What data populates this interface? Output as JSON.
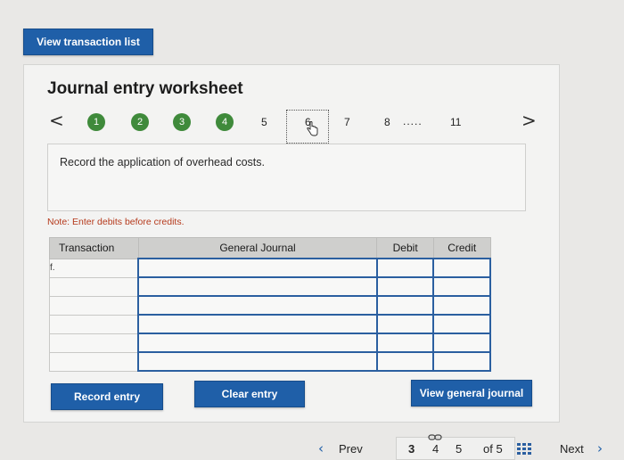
{
  "top": {
    "view_transaction_list": "View transaction list"
  },
  "worksheet": {
    "title": "Journal entry worksheet",
    "nav_prev": "<",
    "nav_next": ">",
    "steps": [
      "1",
      "2",
      "3",
      "4",
      "5",
      "6",
      "7",
      "8",
      "11"
    ],
    "current_step": "6",
    "ellipsis": ".....",
    "prompt": "Record the application of overhead costs.",
    "note": "Note: Enter debits before credits.",
    "table": {
      "headers": [
        "Transaction",
        "General Journal",
        "Debit",
        "Credit"
      ],
      "rows": [
        [
          "f.",
          "",
          "",
          ""
        ],
        [
          "",
          "",
          "",
          ""
        ],
        [
          "",
          "",
          "",
          ""
        ],
        [
          "",
          "",
          "",
          ""
        ],
        [
          "",
          "",
          "",
          ""
        ],
        [
          "",
          "",
          "",
          ""
        ]
      ]
    },
    "buttons": {
      "record": "Record entry",
      "clear": "Clear entry",
      "view_journal": "View general journal"
    }
  },
  "pagination": {
    "prev": "Prev",
    "pages": [
      "3",
      "4",
      "5"
    ],
    "of_label": "of 5",
    "next": "Next"
  },
  "colors": {
    "accent": "#1f5fa8",
    "step_done": "#3f8a3b",
    "note": "#b53a1c"
  }
}
